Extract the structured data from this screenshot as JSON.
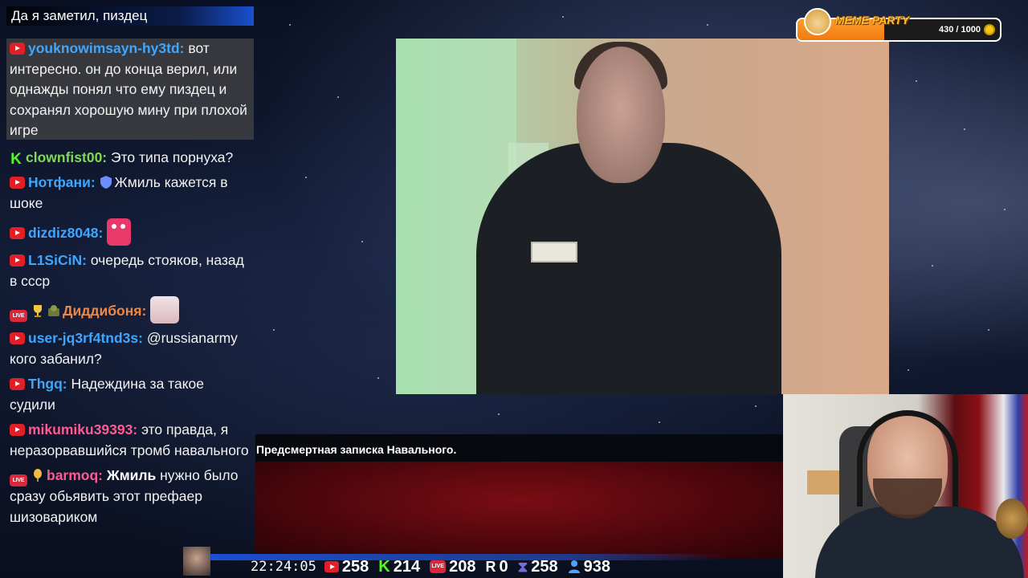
{
  "chat": {
    "top_message": "Да я заметил, пиздец",
    "messages": [
      {
        "platform": "youtube",
        "user": "youknowimsayn-hy3td:",
        "text": "вот интересно. он до конца верил, или однажды понял что ему пиздец и сохранял хорошую мину при плохой игре",
        "highlighted": true
      },
      {
        "platform": "kick",
        "user": "clownfist00:",
        "text": "Это типа порнуха?"
      },
      {
        "platform": "youtube",
        "user": "Нотфани:",
        "text": "Жмиль кажется в шоке",
        "badge_icon": "shield-icon"
      },
      {
        "platform": "youtube",
        "user": "dizdiz8048:",
        "text": "",
        "emote": "monster-emote"
      },
      {
        "platform": "youtube",
        "user": "L1SiCiN:",
        "text": "очередь стояков, назад в ссср"
      },
      {
        "platform": "live",
        "user": "Диддибоня:",
        "text": "",
        "emote": "cat-emote"
      },
      {
        "platform": "youtube",
        "user": "user-jq3rf4tnd3s:",
        "text": "@russianarmy кого забанил?"
      },
      {
        "platform": "youtube",
        "user": "Thgq:",
        "text": "Надеждина за такое судили"
      },
      {
        "platform": "youtube",
        "user": "mikumiku39393:",
        "text": "это правда, я неразорвавшийся тромб навального"
      },
      {
        "platform": "live",
        "user": "barmoq:",
        "mention": "Жмиль",
        "text": " нужно было сразу обьявить этот префаер шизовариком"
      }
    ]
  },
  "video": {
    "caption": "Предсмертная записка Навального."
  },
  "meme_party": {
    "title": "MEME PARTY",
    "progress": "430 / 1000",
    "fraction": 0.43
  },
  "stats": {
    "time": "22:24:05",
    "youtube": "258",
    "kick": "214",
    "vklive": "208",
    "rutube": "0",
    "twitch": "258",
    "total": "938"
  },
  "colors": {
    "youtube_red": "#e01f26",
    "kick_green": "#53fc18",
    "username_blue": "#3ea6ff",
    "accent_blue": "#1a4fd0",
    "meme_orange": "#f07a10"
  }
}
